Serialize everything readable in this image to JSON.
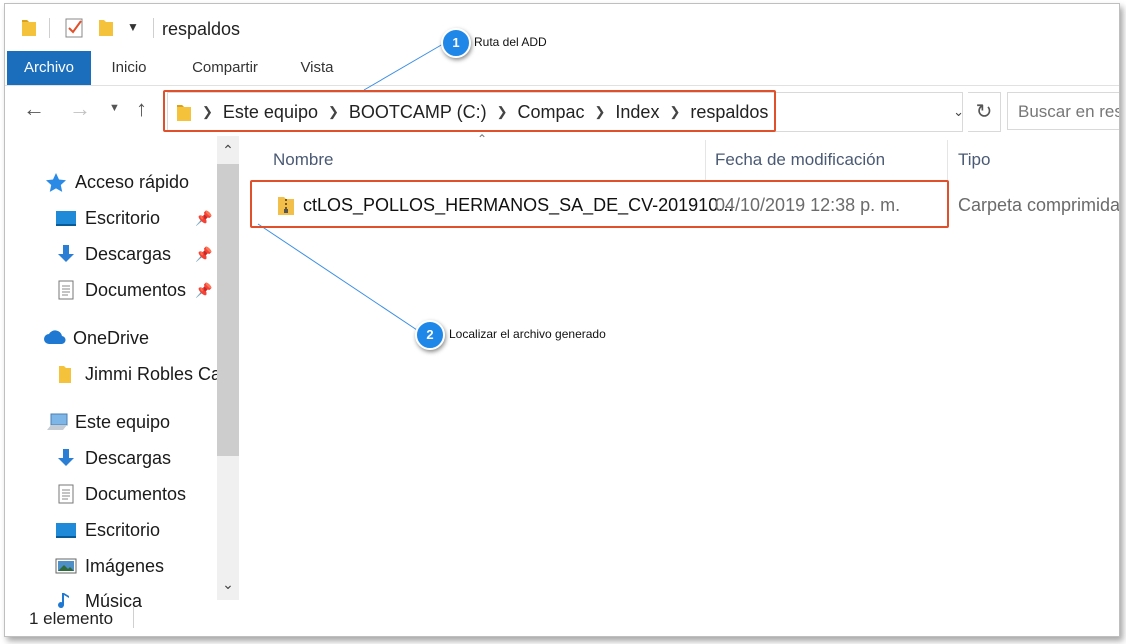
{
  "window": {
    "title": "respaldos"
  },
  "ribbon": {
    "tabs": [
      "Archivo",
      "Inicio",
      "Compartir",
      "Vista"
    ]
  },
  "address": {
    "crumbs": [
      "Este equipo",
      "BOOTCAMP (C:)",
      "Compac",
      "Index",
      "respaldos"
    ],
    "search_placeholder": "Buscar en res"
  },
  "nav": {
    "items": [
      {
        "label": "Acceso rápido",
        "icon": "star-icon",
        "pinned": false
      },
      {
        "label": "Escritorio",
        "icon": "desktop-icon",
        "pinned": true
      },
      {
        "label": "Descargas",
        "icon": "download-icon",
        "pinned": true
      },
      {
        "label": "Documentos",
        "icon": "document-icon",
        "pinned": true
      },
      {
        "label": "OneDrive",
        "icon": "cloud-icon",
        "pinned": false
      },
      {
        "label": "Jimmi Robles Ca",
        "icon": "folder-icon",
        "pinned": false
      },
      {
        "label": "Este equipo",
        "icon": "computer-icon",
        "pinned": false
      },
      {
        "label": "Descargas",
        "icon": "download-icon",
        "pinned": false
      },
      {
        "label": "Documentos",
        "icon": "document-icon",
        "pinned": false
      },
      {
        "label": "Escritorio",
        "icon": "desktop-icon",
        "pinned": false
      },
      {
        "label": "Imágenes",
        "icon": "pictures-icon",
        "pinned": false
      },
      {
        "label": "Música",
        "icon": "music-icon",
        "pinned": false
      }
    ]
  },
  "columns": {
    "name": "Nombre",
    "date": "Fecha de modificación",
    "type": "Tipo"
  },
  "files": [
    {
      "name": "ctLOS_POLLOS_HERMANOS_SA_DE_CV-201910...",
      "date": "04/10/2019 12:38 p. m.",
      "type": "Carpeta comprimida",
      "icon": "zip-folder-icon"
    }
  ],
  "status": {
    "count": "1 elemento"
  },
  "annotations": [
    {
      "number": "1",
      "text": "Ruta del ADD"
    },
    {
      "number": "2",
      "text": "Localizar el archivo generado"
    }
  ],
  "colors": {
    "accent": "#1a6ebb",
    "highlight": "#e0502a",
    "badge": "#1f87e8"
  }
}
